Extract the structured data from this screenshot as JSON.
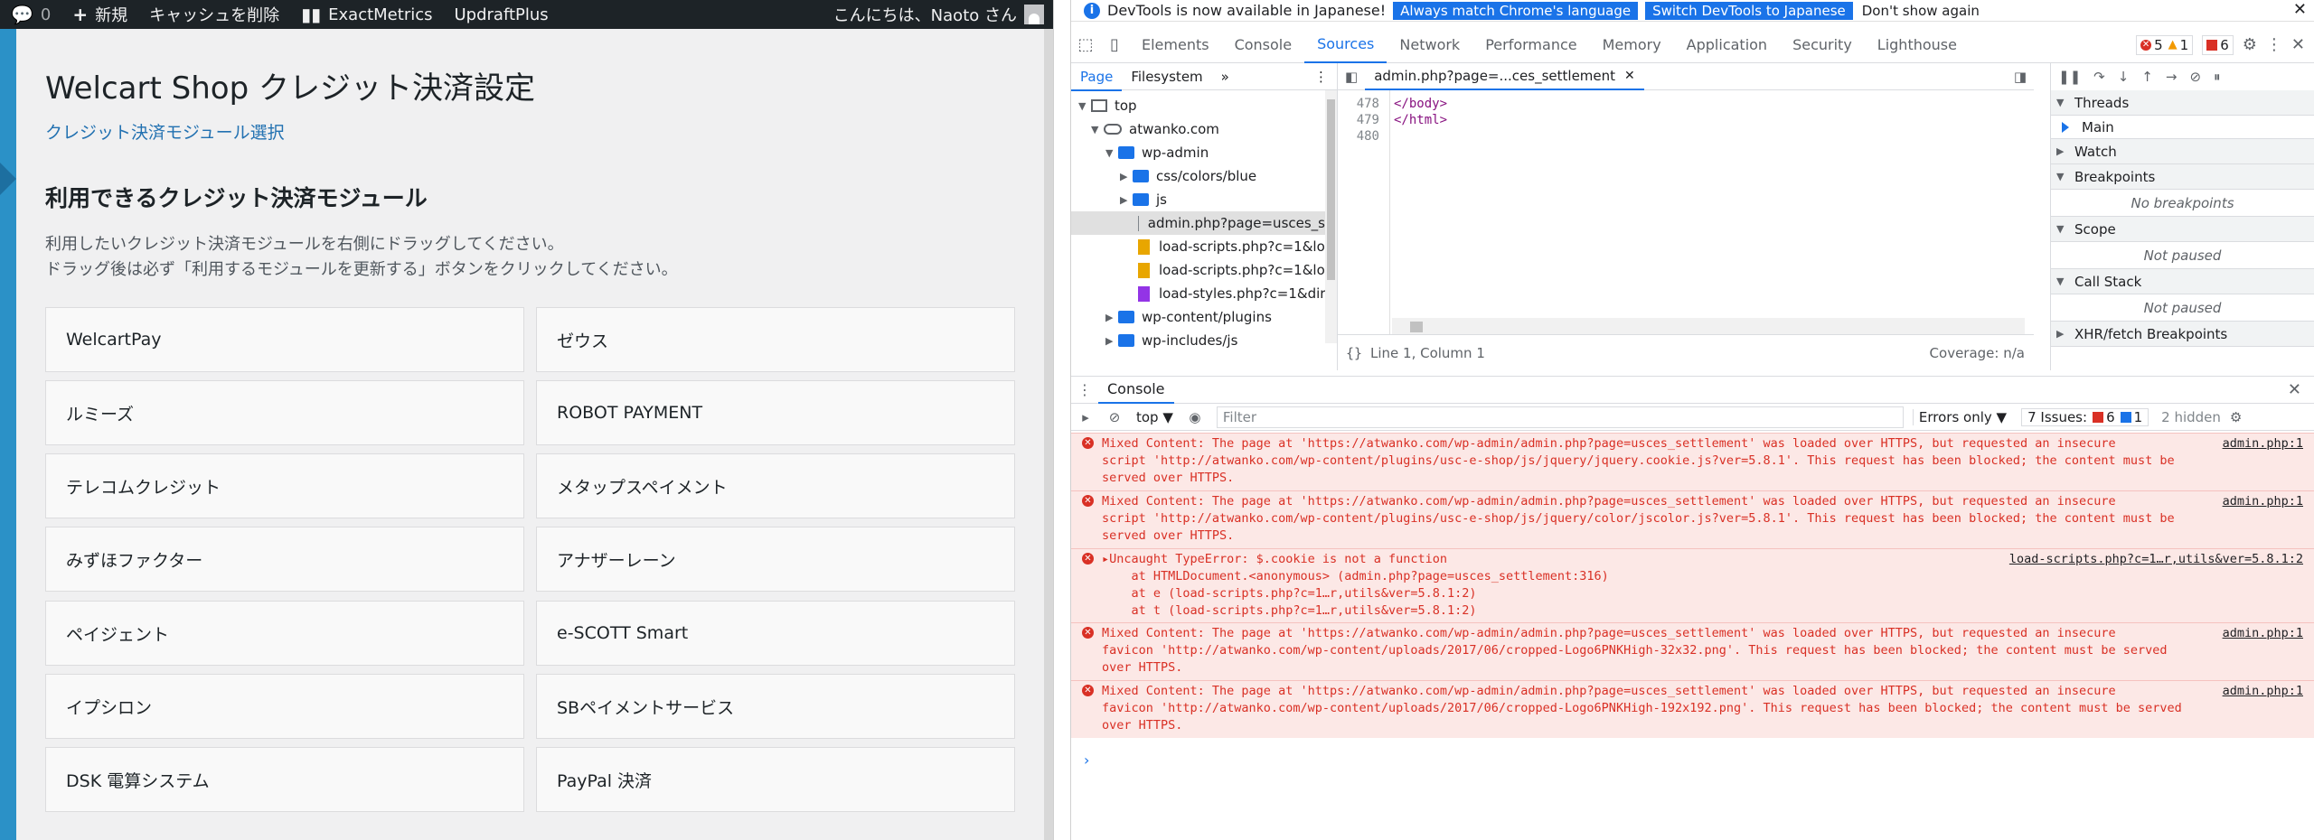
{
  "wp": {
    "adminbar": {
      "comments_count": "0",
      "new_label": "新規",
      "cache_label": "キャッシュを削除",
      "exactmetrics_label": "ExactMetrics",
      "updraft_label": "UpdraftPlus",
      "greeting": "こんにちは、Naoto さん"
    },
    "page_title": "Welcart Shop クレジット決済設定",
    "module_link": "クレジット決済モジュール選択",
    "section_title": "利用できるクレジット決済モジュール",
    "instruction1": "利用したいクレジット決済モジュールを右側にドラッグしてください。",
    "instruction2": "ドラッグ後は必ず「利用するモジュールを更新する」ボタンをクリックしてください。",
    "modules": [
      "WelcartPay",
      "ゼウス",
      "ルミーズ",
      "ROBOT PAYMENT",
      "テレコムクレジット",
      "メタップスペイメント",
      "みずほファクター",
      "アナザーレーン",
      "ペイジェント",
      "e-SCOTT Smart",
      "イプシロン",
      "SBペイメントサービス",
      "DSK 電算システム",
      "PayPal 決済"
    ]
  },
  "devtools": {
    "infobar": {
      "text": "DevTools is now available in Japanese!",
      "btn1": "Always match Chrome's language",
      "btn2": "Switch DevTools to Japanese",
      "link": "Don't show again"
    },
    "tabs": [
      "Elements",
      "Console",
      "Sources",
      "Network",
      "Performance",
      "Memory",
      "Application",
      "Security",
      "Lighthouse"
    ],
    "badges": {
      "errors": "5",
      "warnings": "1",
      "issues": "6"
    },
    "navigator": {
      "tab_page": "Page",
      "tab_filesystem": "Filesystem",
      "more": "»",
      "items": [
        "top",
        "atwanko.com",
        "wp-admin",
        "css/colors/blue",
        "js",
        "admin.php?page=usces_s",
        "load-scripts.php?c=1&loa",
        "load-scripts.php?c=1&loa",
        "load-styles.php?c=1&dir=",
        "wp-content/plugins",
        "wp-includes/js"
      ]
    },
    "editor": {
      "file_tab": "admin.php?page=...ces_settlement",
      "lines": [
        {
          "num": "478",
          "code": "</body>"
        },
        {
          "num": "479",
          "code": "</html>"
        },
        {
          "num": "480",
          "code": ""
        }
      ],
      "pretty": "{}",
      "position": "Line 1, Column 1",
      "coverage": "Coverage: n/a"
    },
    "debugger": {
      "threads": "Threads",
      "main": "Main",
      "watch": "Watch",
      "breakpoints": "Breakpoints",
      "no_breakpoints": "No breakpoints",
      "scope": "Scope",
      "not_paused": "Not paused",
      "callstack": "Call Stack",
      "not_paused2": "Not paused",
      "xhr": "XHR/fetch Breakpoints"
    },
    "console": {
      "tab": "Console",
      "context": "top ▼",
      "filter_placeholder": "Filter",
      "levels": "Errors only ▼",
      "issues_label": "7 Issues:",
      "issues_err": "6",
      "issues_info": "1",
      "hidden": "2 hidden",
      "messages": [
        {
          "text": "Mixed Content: The page at 'https://atwanko.com/wp-admin/admin.php?page=usces_settlement' was loaded over HTTPS, but requested an insecure\nscript 'http://atwanko.com/wp-content/plugins/usc-e-shop/js/jquery/jquery.cookie.js?ver=5.8.1'. This request has been blocked; the content must be\nserved over HTTPS.",
          "src": "admin.php:1"
        },
        {
          "text": "Mixed Content: The page at 'https://atwanko.com/wp-admin/admin.php?page=usces_settlement' was loaded over HTTPS, but requested an insecure\nscript 'http://atwanko.com/wp-content/plugins/usc-e-shop/js/jquery/color/jscolor.js?ver=5.8.1'. This request has been blocked; the content must be\nserved over HTTPS.",
          "src": "admin.php:1"
        },
        {
          "text": "▸Uncaught TypeError: $.cookie is not a function\n    at HTMLDocument.<anonymous> (admin.php?page=usces_settlement:316)\n    at e (load-scripts.php?c=1…r,utils&ver=5.8.1:2)\n    at t (load-scripts.php?c=1…r,utils&ver=5.8.1:2)",
          "src": "load-scripts.php?c=1…r,utils&ver=5.8.1:2"
        },
        {
          "text": "Mixed Content: The page at 'https://atwanko.com/wp-admin/admin.php?page=usces_settlement' was loaded over HTTPS, but requested an insecure\nfavicon 'http://atwanko.com/wp-content/uploads/2017/06/cropped-Logo6PNKHigh-32x32.png'. This request has been blocked; the content must be served\nover HTTPS.",
          "src": "admin.php:1"
        },
        {
          "text": "Mixed Content: The page at 'https://atwanko.com/wp-admin/admin.php?page=usces_settlement' was loaded over HTTPS, but requested an insecure\nfavicon 'http://atwanko.com/wp-content/uploads/2017/06/cropped-Logo6PNKHigh-192x192.png'. This request has been blocked; the content must be served\nover HTTPS.",
          "src": "admin.php:1"
        }
      ],
      "prompt": "›"
    }
  }
}
